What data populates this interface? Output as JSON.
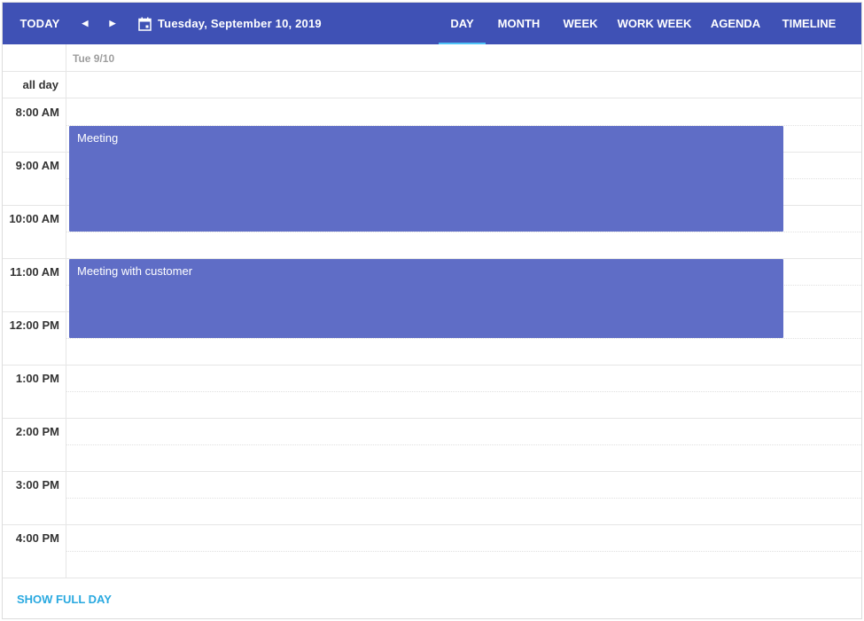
{
  "toolbar": {
    "today_label": "TODAY",
    "prev_icon": "triangle-left-icon",
    "next_icon": "triangle-right-icon",
    "calendar_icon": "calendar-icon",
    "current_date": "Tuesday, September 10, 2019",
    "views": [
      "DAY",
      "MONTH",
      "WEEK",
      "WORK WEEK",
      "AGENDA",
      "TIMELINE"
    ],
    "active_view": "DAY"
  },
  "header": {
    "date_label": "Tue 9/10",
    "allday_label": "all day"
  },
  "times": [
    "8:00 AM",
    "9:00 AM",
    "10:00 AM",
    "11:00 AM",
    "12:00 PM",
    "1:00 PM",
    "2:00 PM",
    "3:00 PM",
    "4:00 PM"
  ],
  "appointments": [
    {
      "subject": "Meeting"
    },
    {
      "subject": "Meeting with customer"
    }
  ],
  "footer": {
    "show_full_day_label": "SHOW FULL DAY"
  },
  "colors": {
    "toolbar_bg": "#3f51b5",
    "active_tab_indicator": "#4fc3f7",
    "appointment_bg": "#5f6dc6",
    "link": "#29a9e0"
  }
}
